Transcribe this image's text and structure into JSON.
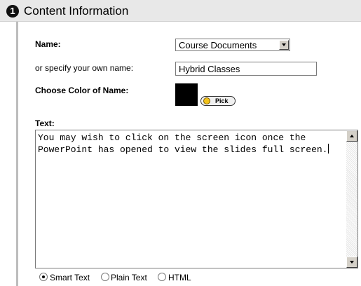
{
  "section": {
    "step_number": "1",
    "title": "Content Information"
  },
  "name_field": {
    "label": "Name:",
    "selected_value": "Course Documents"
  },
  "custom_name": {
    "label": "or specify your own name:",
    "value": "Hybrid Classes"
  },
  "color": {
    "label": "Choose Color of Name:",
    "swatch_color": "#000000",
    "pick_label": "Pick"
  },
  "text_field": {
    "label": "Text:",
    "value": "You may wish to click on the screen icon once the PowerPoint has opened to view the slides full screen."
  },
  "format_options": [
    {
      "label": "Smart Text",
      "selected": true
    },
    {
      "label": "Plain Text",
      "selected": false
    },
    {
      "label": "HTML",
      "selected": false
    }
  ]
}
